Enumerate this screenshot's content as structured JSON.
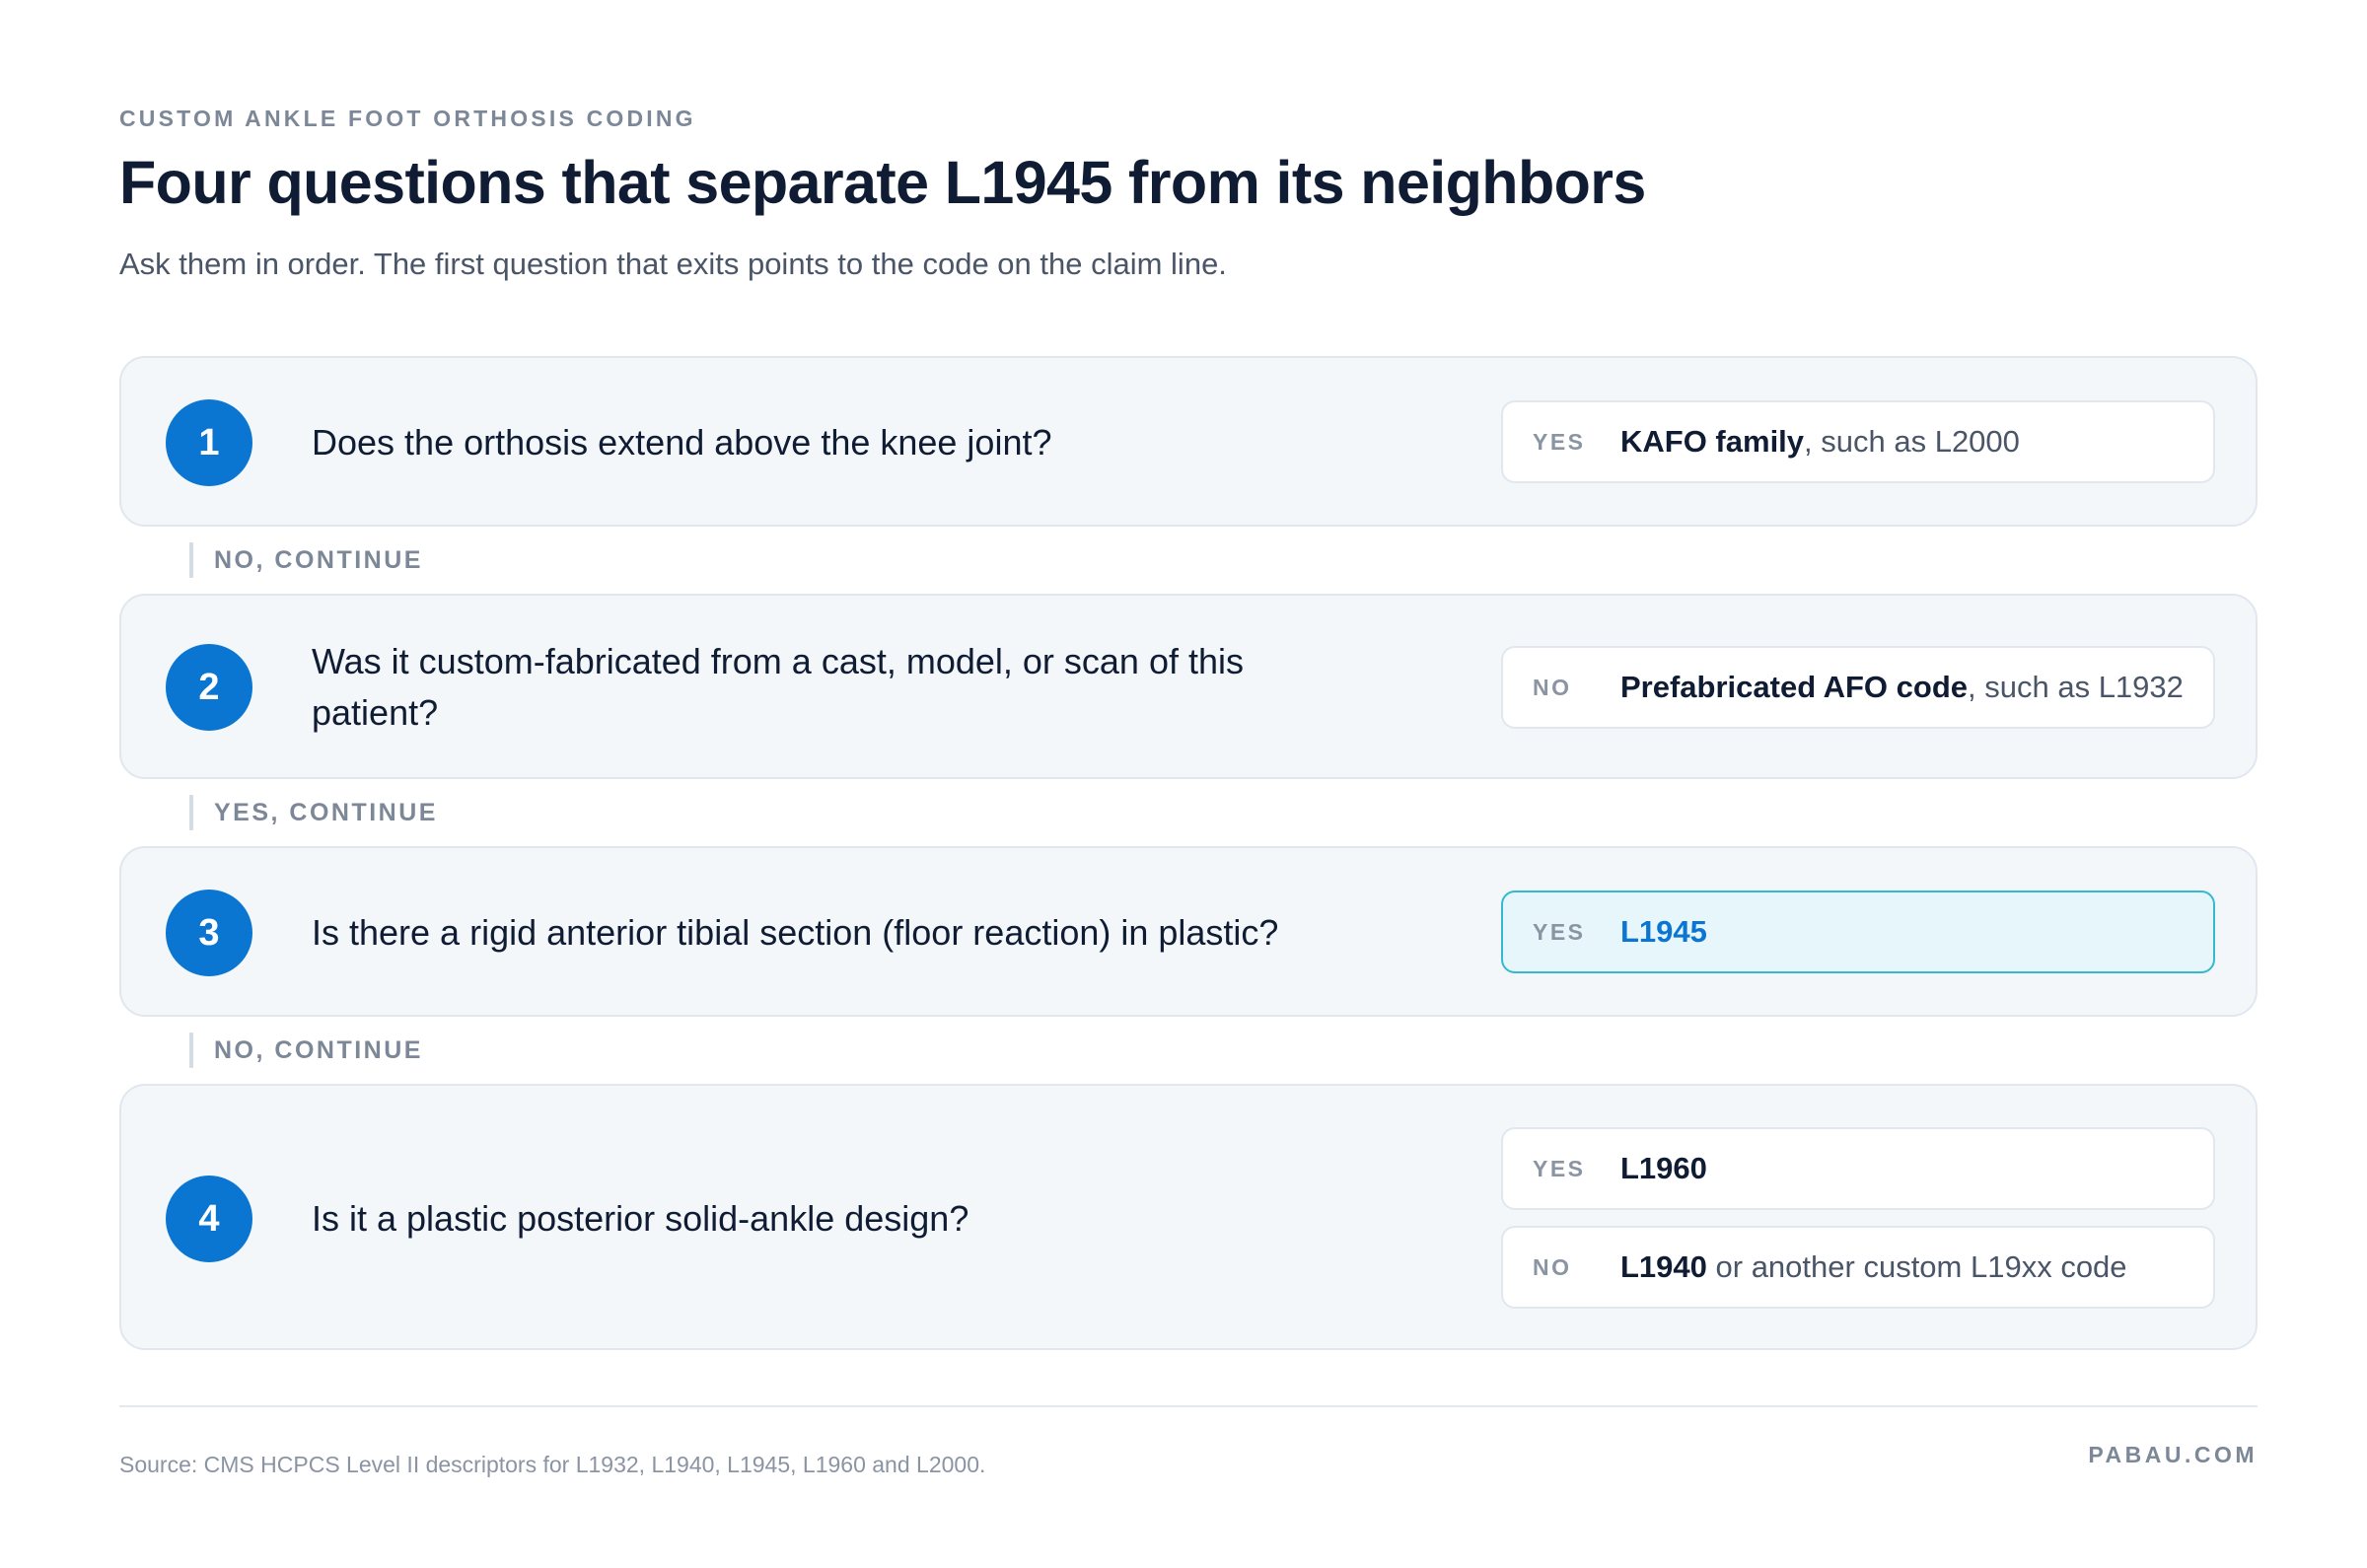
{
  "header": {
    "eyebrow": "CUSTOM ANKLE FOOT ORTHOSIS CODING",
    "title": "Four questions that separate L1945 from its neighbors",
    "subtitle": "Ask them in order. The first question that exits points to the code on the claim line."
  },
  "steps": [
    {
      "number": "1",
      "question": "Does the orthosis extend above the knee joint?",
      "outcomes": [
        {
          "tag": "YES",
          "code": "KAFO family",
          "detail": ", such as L2000"
        }
      ]
    },
    {
      "number": "2",
      "question": "Was it custom-fabricated from a cast, model, or scan of this patient?",
      "outcomes": [
        {
          "tag": "NO",
          "code": "Prefabricated AFO code",
          "detail": ", such as L1932"
        }
      ]
    },
    {
      "number": "3",
      "question": "Is there a rigid anterior tibial section (floor reaction) in plastic?",
      "outcomes": [
        {
          "tag": "YES",
          "code": "L1945",
          "detail": ""
        }
      ]
    },
    {
      "number": "4",
      "question": "Is it a plastic posterior solid-ankle design?",
      "outcomes": [
        {
          "tag": "YES",
          "code": "L1960",
          "detail": ""
        },
        {
          "tag": "NO",
          "code": "L1940",
          "detail": " or another custom L19xx code"
        }
      ]
    }
  ],
  "connectors": [
    "NO, CONTINUE",
    "YES, CONTINUE",
    "NO, CONTINUE"
  ],
  "footer": {
    "source": "Source: CMS HCPCS Level II descriptors for L1932, L1940, L1945, L1960 and L2000.",
    "brand": "PABAU.COM"
  },
  "colors": {
    "accent": "#0b76d1",
    "highlight_border": "#35b9cf",
    "highlight_fill": "#e6f6fa",
    "card_fill": "#f3f7fa"
  }
}
